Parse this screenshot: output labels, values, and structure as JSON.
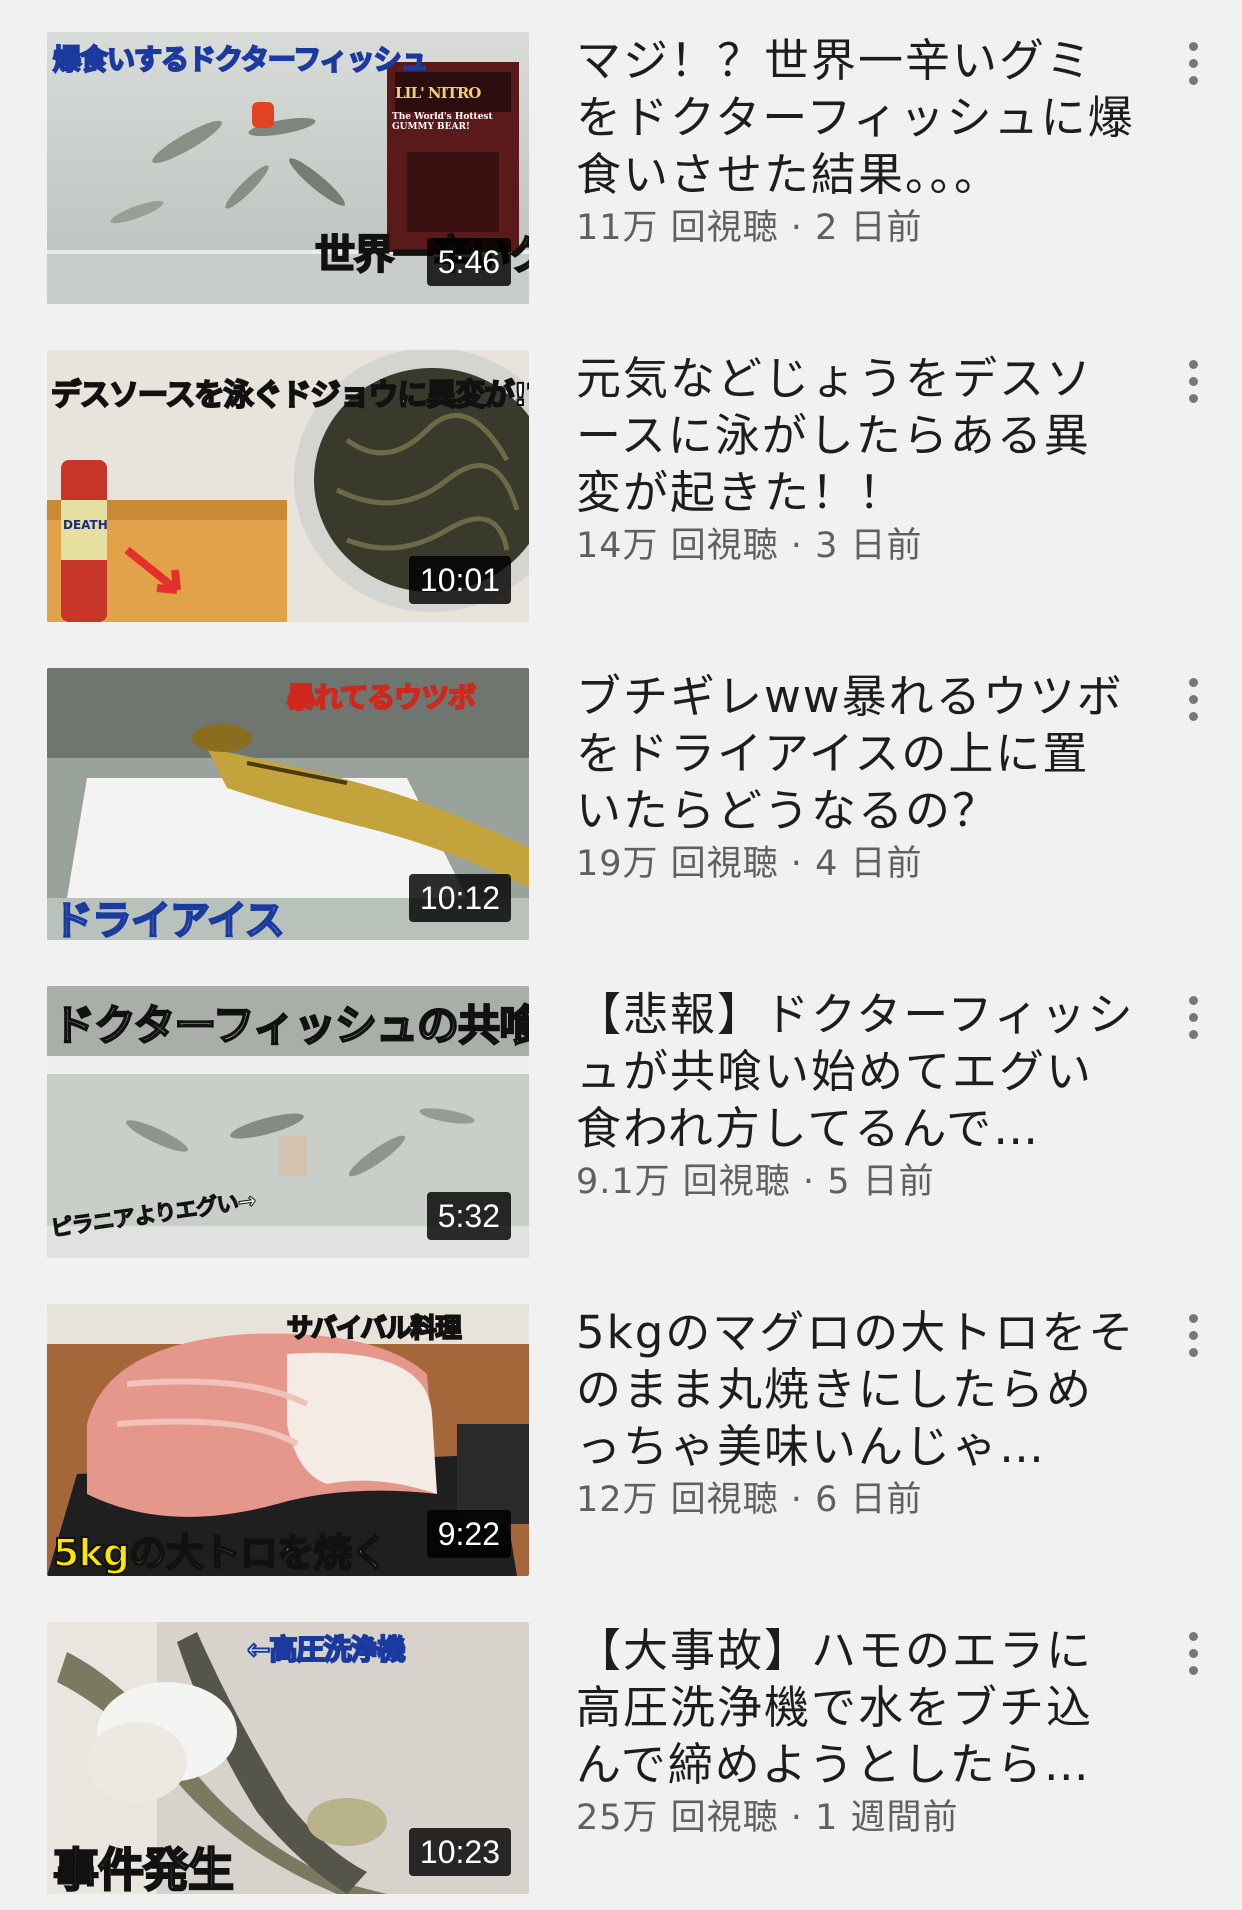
{
  "colors": {
    "background": "#f1f1f1",
    "title": "#1d1d1d",
    "stats": "#606060",
    "duration_bg": "#000000",
    "duration_text": "#ffffff",
    "menu_dots": "#777777"
  },
  "videos": [
    {
      "title": "マジ！？世界一辛いグミをドクターフィッシュに爆食いさせた結果。。。",
      "views": "11万 回視聴",
      "age": "2 日前",
      "duration": "5:46",
      "thumbnail_text": [
        "爆食いするドクターフィッシュ",
        "世界一辛いグミ",
        "LIL' NITRO",
        "The World's Hottest GUMMY BEAR!"
      ]
    },
    {
      "title": "元気などじょうをデスソースに泳がしたらある異変が起きた！！",
      "views": "14万 回視聴",
      "age": "3 日前",
      "duration": "10:01",
      "thumbnail_text": [
        "デスソースを泳ぐドジョウに異変が!?",
        "DEATH"
      ]
    },
    {
      "title": "ブチギレww暴れるウツボをドライアイスの上に置いたらどうなるの？",
      "views": "19万 回視聴",
      "age": "4 日前",
      "duration": "10:12",
      "thumbnail_text": [
        "暴れてるウツボ",
        "ドライアイス"
      ]
    },
    {
      "title": "【悲報】ドクターフィッシュが共喰い始めてエグい食われ方してるんで…",
      "views": "9.1万 回視聴",
      "age": "5 日前",
      "duration": "5:32",
      "thumbnail_text": [
        "ドクターフィッシュの共喰い",
        "ピラニアよりエグい→"
      ]
    },
    {
      "title": "5kgのマグロの大トロをそのまま丸焼きにしたらめっちゃ美味いんじゃ…",
      "views": "12万 回視聴",
      "age": "6 日前",
      "duration": "9:22",
      "thumbnail_text": [
        "サバイバル料理",
        "5kgの大トロを焼く"
      ]
    },
    {
      "title": "【大事故】ハモのエラに高圧洗浄機で水をブチ込んで締めようとしたら…",
      "views": "25万 回視聴",
      "age": "1 週間前",
      "duration": "10:23",
      "thumbnail_text": [
        "←高圧洗浄機",
        "事件発生"
      ]
    }
  ]
}
